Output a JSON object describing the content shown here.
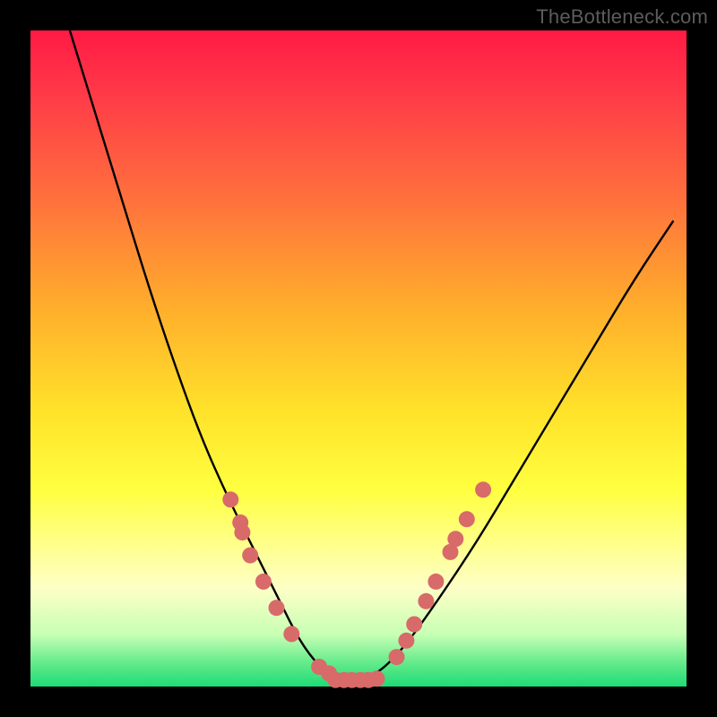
{
  "watermark": "TheBottleneck.com",
  "chart_data": {
    "type": "line",
    "title": "",
    "xlabel": "",
    "ylabel": "",
    "xlim": [
      0,
      1
    ],
    "ylim": [
      0,
      1
    ],
    "background_gradient": {
      "orientation": "vertical",
      "stops": [
        {
          "pos": 0.0,
          "color": "#ff1a44"
        },
        {
          "pos": 0.25,
          "color": "#ff6e3d"
        },
        {
          "pos": 0.58,
          "color": "#ffe22a"
        },
        {
          "pos": 0.78,
          "color": "#ffff88"
        },
        {
          "pos": 0.92,
          "color": "#c8ffb4"
        },
        {
          "pos": 1.0,
          "color": "#1edc76"
        }
      ]
    },
    "x": [
      0.06,
      0.1,
      0.14,
      0.18,
      0.22,
      0.26,
      0.3,
      0.34,
      0.38,
      0.41,
      0.44,
      0.47,
      0.5,
      0.53,
      0.57,
      0.62,
      0.68,
      0.74,
      0.8,
      0.86,
      0.92,
      0.98
    ],
    "y": [
      1.0,
      0.87,
      0.74,
      0.61,
      0.49,
      0.38,
      0.29,
      0.21,
      0.13,
      0.07,
      0.03,
      0.01,
      0.01,
      0.02,
      0.06,
      0.13,
      0.22,
      0.32,
      0.42,
      0.52,
      0.62,
      0.71
    ],
    "points_left": [
      {
        "x": 0.305,
        "y": 0.285
      },
      {
        "x": 0.32,
        "y": 0.25
      },
      {
        "x": 0.323,
        "y": 0.235
      },
      {
        "x": 0.335,
        "y": 0.2
      },
      {
        "x": 0.355,
        "y": 0.16
      },
      {
        "x": 0.375,
        "y": 0.12
      },
      {
        "x": 0.398,
        "y": 0.08
      },
      {
        "x": 0.44,
        "y": 0.03
      },
      {
        "x": 0.455,
        "y": 0.02
      }
    ],
    "points_bottom": [
      {
        "x": 0.465,
        "y": 0.01
      },
      {
        "x": 0.478,
        "y": 0.01
      },
      {
        "x": 0.49,
        "y": 0.01
      },
      {
        "x": 0.503,
        "y": 0.01
      },
      {
        "x": 0.515,
        "y": 0.01
      },
      {
        "x": 0.528,
        "y": 0.012
      }
    ],
    "points_right": [
      {
        "x": 0.558,
        "y": 0.045
      },
      {
        "x": 0.573,
        "y": 0.07
      },
      {
        "x": 0.585,
        "y": 0.095
      },
      {
        "x": 0.603,
        "y": 0.13
      },
      {
        "x": 0.618,
        "y": 0.16
      },
      {
        "x": 0.64,
        "y": 0.205
      },
      {
        "x": 0.648,
        "y": 0.225
      },
      {
        "x": 0.665,
        "y": 0.255
      },
      {
        "x": 0.69,
        "y": 0.3
      }
    ]
  }
}
